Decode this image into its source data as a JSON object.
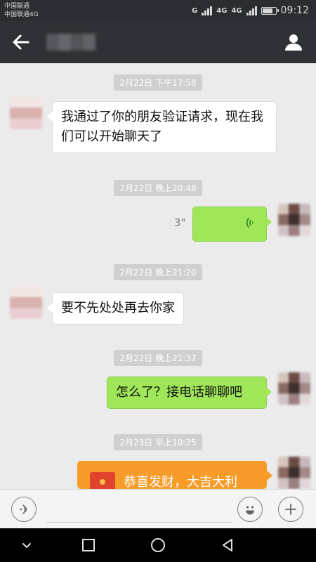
{
  "status_bar": {
    "carrier_1": "中国联通",
    "carrier_2": "中国联通4G",
    "signal_1_label": "G",
    "signal_2_label": "4G",
    "signal_3_label": "4G",
    "time": "09:12",
    "battery_level": 0.8
  },
  "chat": {
    "timestamps": [
      "2月22日 下午17:58",
      "2月22日 晚上20:48",
      "2月22日 晚上21:20",
      "2月22日 晚上21:37",
      "2月23日 早上10:25"
    ],
    "messages": [
      {
        "direction": "in",
        "text": "我通过了你的朋友验证请求，现在我们可以开始聊天了"
      },
      {
        "direction": "out",
        "type": "voice",
        "duration": "3\""
      },
      {
        "direction": "in",
        "text": "要不先处处再去你家"
      },
      {
        "direction": "out",
        "text": "怎么了？接电话聊聊吧"
      },
      {
        "direction": "out",
        "type": "red_packet",
        "text": "恭喜发财，大吉大利"
      }
    ]
  },
  "colors": {
    "outgoing_bubble": "#9fe658",
    "incoming_bubble": "#ffffff",
    "red_packet": "#f79c2a",
    "title_bar": "#2e3135"
  },
  "icons": {
    "back": "arrow-left-icon",
    "profile": "person-icon",
    "voice_input": "voice-input-icon",
    "emoji": "smiley-icon",
    "more": "plus-icon",
    "nav": [
      "chevron-down-icon",
      "square-icon",
      "circle-icon",
      "triangle-back-icon"
    ]
  }
}
